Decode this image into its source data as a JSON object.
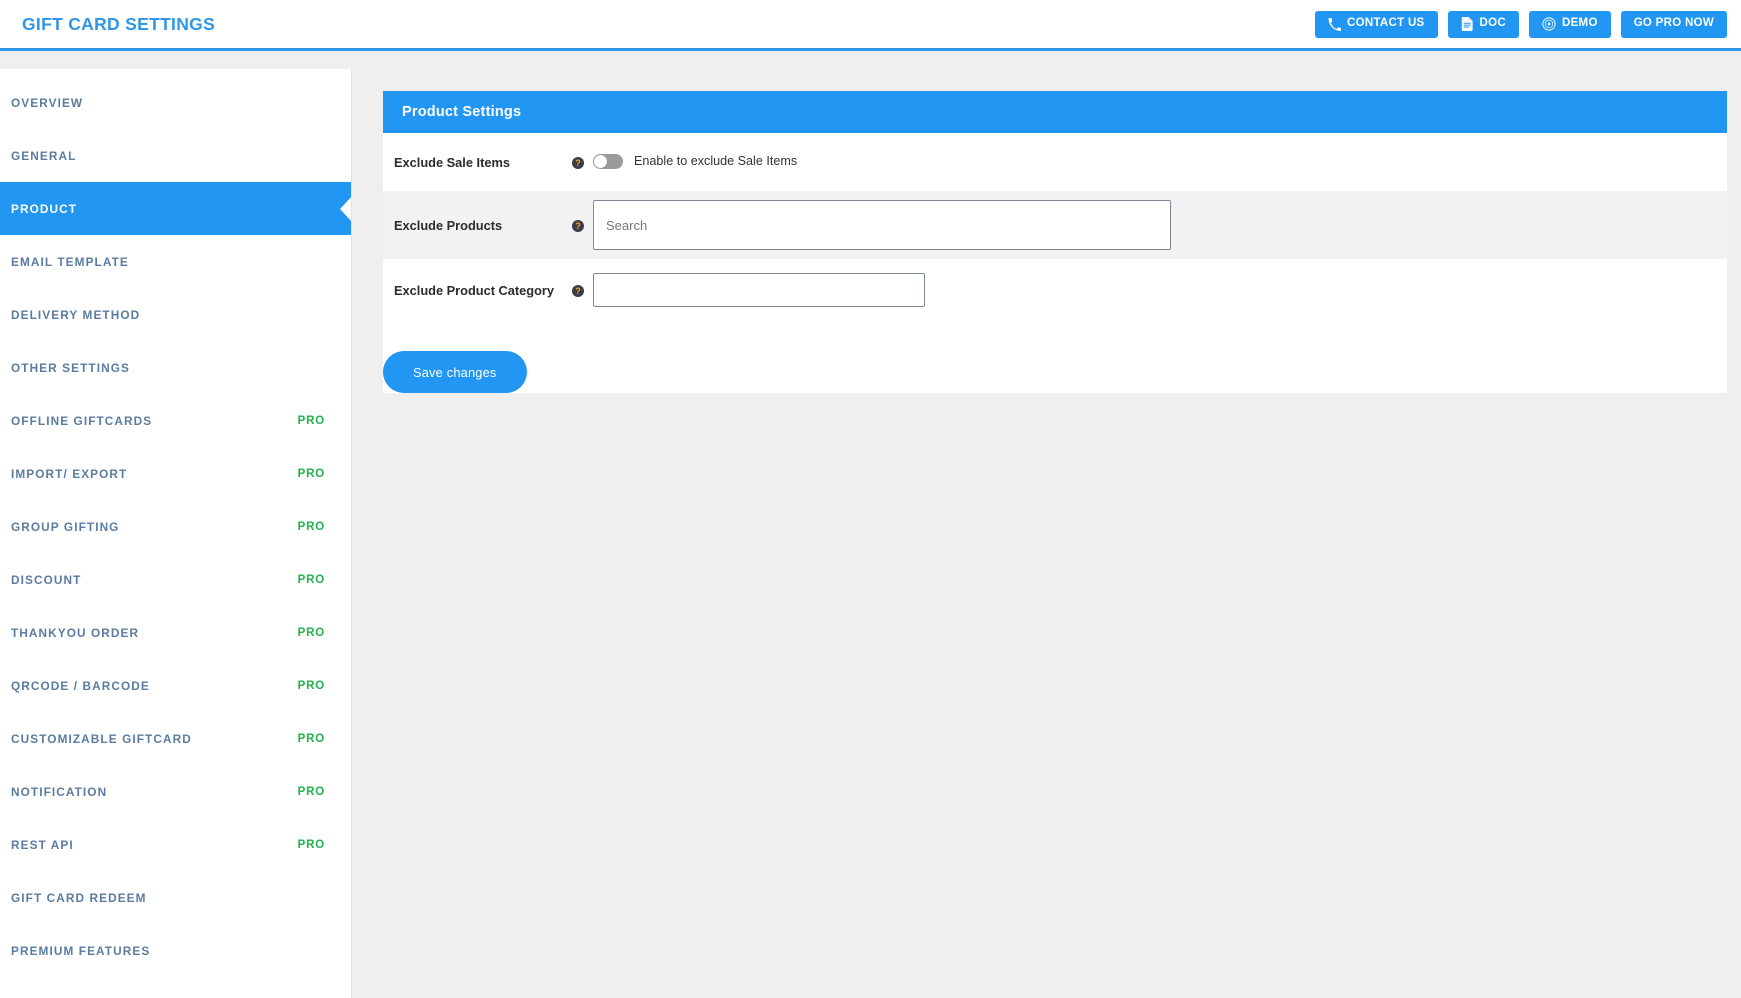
{
  "header": {
    "title": "GIFT CARD SETTINGS",
    "accent_color": "#2f96e8",
    "buttons": [
      {
        "label": "CONTACT US",
        "icon": "phone-icon"
      },
      {
        "label": "DOC",
        "icon": "document-icon"
      },
      {
        "label": "DEMO",
        "icon": "play-circle-icon"
      },
      {
        "label": "GO PRO NOW",
        "icon": ""
      }
    ]
  },
  "sidebar": {
    "active_color": "#2196f3",
    "pro_color": "#22b14c",
    "items": [
      {
        "label": "OVERVIEW",
        "pro": "",
        "active": false
      },
      {
        "label": "GENERAL",
        "pro": "",
        "active": false
      },
      {
        "label": "PRODUCT",
        "pro": "",
        "active": true
      },
      {
        "label": "EMAIL TEMPLATE",
        "pro": "",
        "active": false
      },
      {
        "label": "DELIVERY METHOD",
        "pro": "",
        "active": false
      },
      {
        "label": "OTHER SETTINGS",
        "pro": "",
        "active": false
      },
      {
        "label": "OFFLINE GIFTCARDS",
        "pro": "PRO",
        "active": false
      },
      {
        "label": "IMPORT/ EXPORT",
        "pro": "PRO",
        "active": false
      },
      {
        "label": "GROUP GIFTING",
        "pro": "PRO",
        "active": false
      },
      {
        "label": "DISCOUNT",
        "pro": "PRO",
        "active": false
      },
      {
        "label": "THANKYOU ORDER",
        "pro": "PRO",
        "active": false
      },
      {
        "label": "QRCODE / BARCODE",
        "pro": "PRO",
        "active": false
      },
      {
        "label": "CUSTOMIZABLE GIFTCARD",
        "pro": "PRO",
        "active": false
      },
      {
        "label": "NOTIFICATION",
        "pro": "PRO",
        "active": false
      },
      {
        "label": "REST API",
        "pro": "PRO",
        "active": false
      },
      {
        "label": "GIFT CARD REDEEM",
        "pro": "",
        "active": false
      },
      {
        "label": "PREMIUM FEATURES",
        "pro": "",
        "active": false
      }
    ]
  },
  "panel": {
    "title": "Product Settings",
    "rows": {
      "sale_items": {
        "label": "Exclude Sale Items",
        "help": "?",
        "toggle_state": "off",
        "toggle_text": "Enable to exclude Sale Items"
      },
      "products": {
        "label": "Exclude Products",
        "help": "?",
        "placeholder": "Search",
        "value": ""
      },
      "category": {
        "label": "Exclude Product Category",
        "help": "?",
        "placeholder": "",
        "value": ""
      }
    },
    "save_label": "Save changes"
  }
}
